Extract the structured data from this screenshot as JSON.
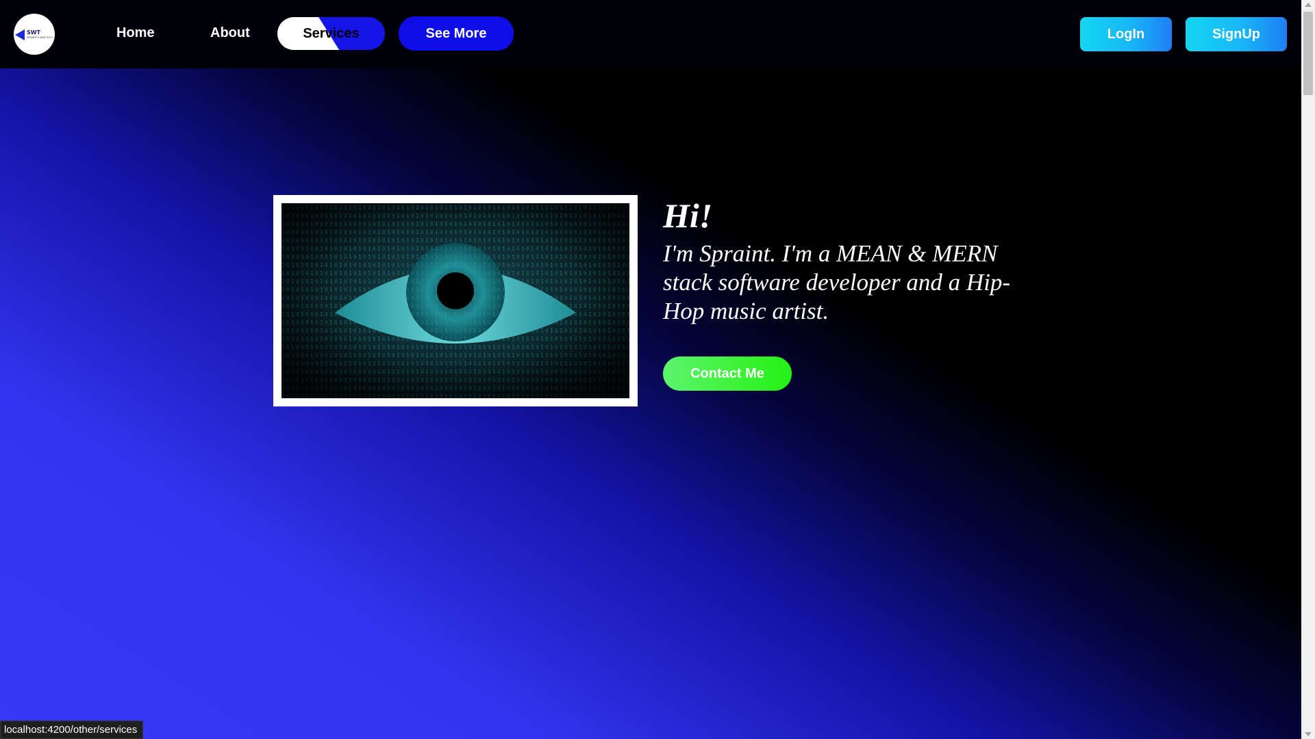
{
  "logo": {
    "text": "SWT",
    "subtext": "SPRAINT'S WEB TECH"
  },
  "nav": {
    "links": [
      "Home",
      "About"
    ],
    "services_label": "Services",
    "see_more_label": "See More",
    "login_label": "LogIn",
    "signup_label": "SignUp"
  },
  "hero": {
    "greeting": "Hi!",
    "intro": "I'm Spraint. I'm a MEAN & MERN stack software developer and a Hip-Hop music artist.",
    "contact_label": "Contact Me",
    "image_icon": "binary-eye-image"
  },
  "status_bar": {
    "url": "localhost:4200/other/services"
  },
  "colors": {
    "background_light": "#3737f5",
    "background_dark": "#000000",
    "nav_bg": "#000008",
    "see_more": "#0d0de8",
    "auth_gradient_start": "#14d6f2",
    "auth_gradient_end": "#1f7ef6",
    "contact_gradient_start": "#5cf56e",
    "contact_gradient_end": "#22f215"
  }
}
